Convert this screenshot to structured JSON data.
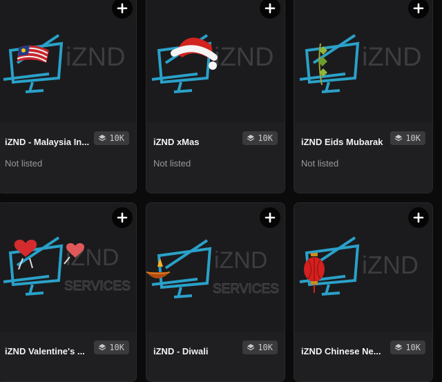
{
  "cards": [
    {
      "title": "iZND - Malaysia In...",
      "badge": "10K",
      "status": "Not listed",
      "logo_text": "iZND",
      "accent": "flag-icon"
    },
    {
      "title": "iZND xMas",
      "badge": "10K",
      "status": "Not listed",
      "logo_text": "iZND",
      "accent": "santa-hat-icon"
    },
    {
      "title": "iZND Eids Mubarak",
      "badge": "10K",
      "status": "Not listed",
      "logo_text": "iZND",
      "accent": "ketupat-icon"
    },
    {
      "title": "iZND Valentine's ...",
      "badge": "10K",
      "logo_text": "iZND",
      "logo_sub": "SERVICES",
      "accent": "hearts-icon"
    },
    {
      "title": "iZND - Diwali",
      "badge": "10K",
      "logo_text": "iZND",
      "logo_sub": "SERVICES",
      "accent": "diya-lamp-icon"
    },
    {
      "title": "iZND Chinese Ne...",
      "badge": "10K",
      "logo_text": "iZND",
      "accent": "lantern-icon"
    }
  ],
  "colors": {
    "card_bg": "#1b1b1d",
    "logo_blue": "#2aa1c9",
    "logo_text": "#3d3d40",
    "title": "#f2f2f2",
    "muted": "#9a9a9a"
  }
}
